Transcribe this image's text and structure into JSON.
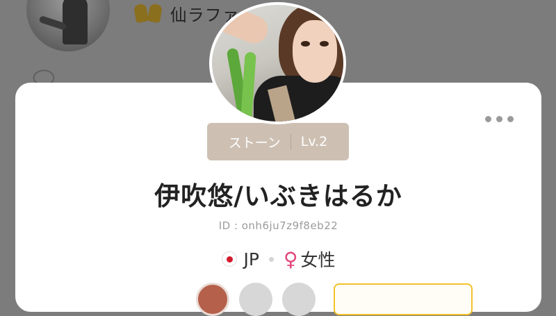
{
  "background": {
    "feed_name": "仙ラファ"
  },
  "profile": {
    "rank_label": "ストーン",
    "level": "Lv.2",
    "display_name": "伊吹悠/いぶきはるか",
    "id_text": "ID : onh6ju7z9f8eb22",
    "country": "JP",
    "gender": "女性",
    "gender_symbol": "♀"
  },
  "colors": {
    "rank_pill": "#cdc0b3",
    "gender": "#e2477a",
    "flag_red": "#d31a2b",
    "follow_border": "#f3c12b"
  },
  "icons": {
    "more": "more-dots-icon",
    "flag": "japan-flag-icon",
    "gender": "female-icon"
  }
}
